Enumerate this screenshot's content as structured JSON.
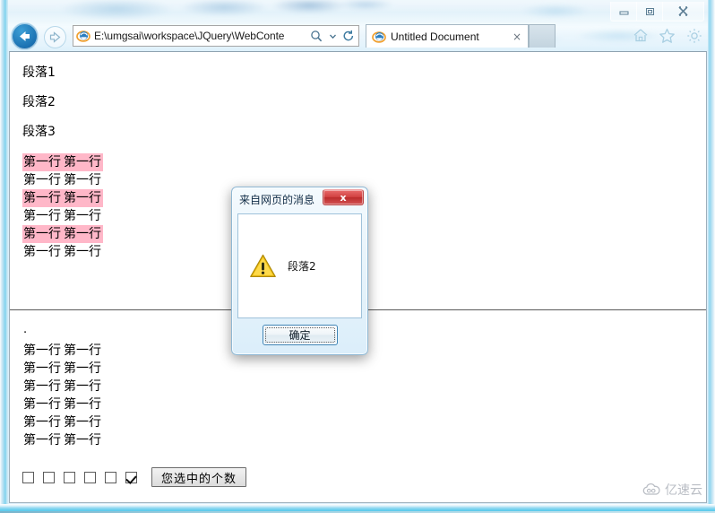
{
  "window": {
    "caption_buttons": [
      {
        "name": "minimize",
        "glyph": "minimize-icon"
      },
      {
        "name": "restore",
        "glyph": "restore-icon"
      },
      {
        "name": "close",
        "glyph": "close-icon"
      }
    ]
  },
  "browser": {
    "back_label": "Back",
    "forward_label": "Forward",
    "address": {
      "value": "E:\\umgsai\\workspace\\JQuery\\WebConte",
      "placeholder": "",
      "search_icon": "search-icon",
      "dropdown_icon": "chevron-down-icon",
      "refresh_icon": "refresh-icon"
    },
    "tabs": [
      {
        "title": "Untitled Document",
        "close_label": "×",
        "active": true
      }
    ],
    "new_tab_label": "",
    "tools": [
      {
        "name": "home-icon",
        "label": "Home"
      },
      {
        "name": "favorites-icon",
        "label": "Favorites"
      },
      {
        "name": "settings-icon",
        "label": "Tools"
      }
    ]
  },
  "page": {
    "paragraphs": [
      "段落1",
      "段落2",
      "段落3"
    ],
    "dot": ".",
    "table1": {
      "highlight_color": "#ffb7c8",
      "rows": [
        {
          "cells": [
            "第一行",
            "第一行"
          ],
          "highlight": true
        },
        {
          "cells": [
            "第一行",
            "第一行"
          ],
          "highlight": false
        },
        {
          "cells": [
            "第一行",
            "第一行"
          ],
          "highlight": true
        },
        {
          "cells": [
            "第一行",
            "第一行"
          ],
          "highlight": false
        },
        {
          "cells": [
            "第一行",
            "第一行"
          ],
          "highlight": true
        },
        {
          "cells": [
            "第一行",
            "第一行"
          ],
          "highlight": false
        }
      ]
    },
    "table2": {
      "rows": [
        {
          "cells": [
            "第一行",
            "第一行"
          ],
          "highlight": false
        },
        {
          "cells": [
            "第一行",
            "第一行"
          ],
          "highlight": false
        },
        {
          "cells": [
            "第一行",
            "第一行"
          ],
          "highlight": false
        },
        {
          "cells": [
            "第一行",
            "第一行"
          ],
          "highlight": false
        },
        {
          "cells": [
            "第一行",
            "第一行"
          ],
          "highlight": false
        },
        {
          "cells": [
            "第一行",
            "第一行"
          ],
          "highlight": false
        }
      ]
    },
    "checkboxes": [
      {
        "checked": false
      },
      {
        "checked": false
      },
      {
        "checked": false
      },
      {
        "checked": false
      },
      {
        "checked": false
      },
      {
        "checked": true
      }
    ],
    "count_button_label": "您选中的个数"
  },
  "dialog": {
    "title": "来自网页的消息",
    "close_label": "x",
    "icon": "warning-icon",
    "message": "段落2",
    "ok_label": "确定"
  },
  "watermark": {
    "text": "亿速云",
    "icon": "cloud-logo-icon",
    "color": "#b9bdc4"
  }
}
